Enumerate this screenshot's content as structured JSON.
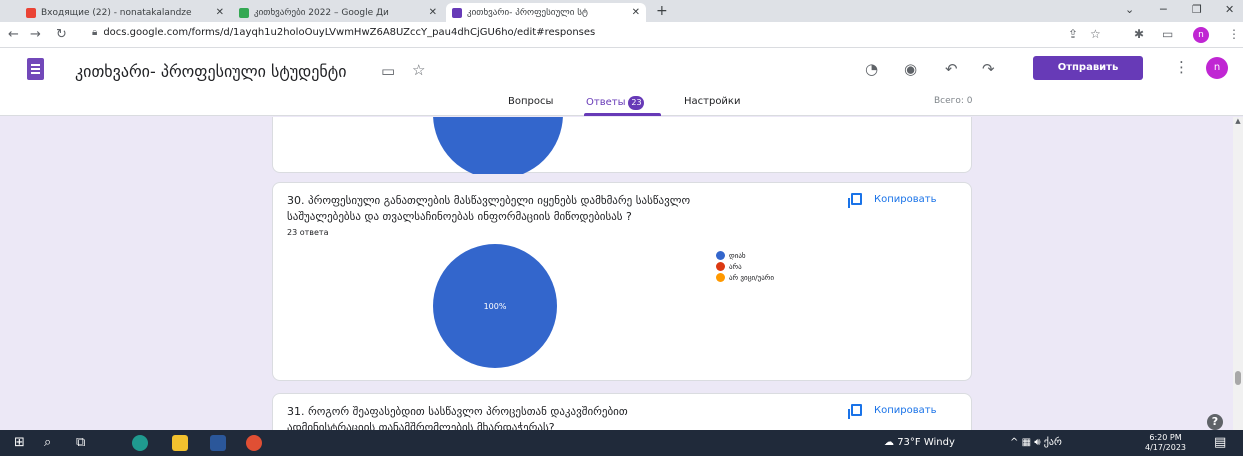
{
  "browser": {
    "tabs": [
      {
        "title": "Входящие (22) - nonatakalandze",
        "active": false,
        "color": "#ea4335"
      },
      {
        "title": "კითხვარები 2022 – Google Ди",
        "active": false,
        "color": "#34a853"
      },
      {
        "title": "კითხვარი- პროფესიული სტ",
        "active": true,
        "color": "#673ab7"
      }
    ],
    "new_tab": "+",
    "close": "✕",
    "url": "docs.google.com/forms/d/1ayqh1u2holoOuyLVwmHwZ6A8UZccY_pau4dhCjGU6ho/edit#responses"
  },
  "form": {
    "title": "კითხვარი- პროფესიული სტუდენტი",
    "send_label": "Отправить",
    "profile_initial": "n",
    "tabs": {
      "questions": "Вопросы",
      "responses": "Ответы",
      "responses_count": "23",
      "settings": "Настройки"
    },
    "total_label": "Всего: 0"
  },
  "questions": [
    {
      "title_line1": "30. პროფესიული განათლების მასწავლებელი იყენებს დამხმარე სასწავლო",
      "title_line2": "საშუალებებსა და თვალსაჩინოებას ინფორმაციის მიწოდებისას ?",
      "count": "23 ответа",
      "copy_label": "Копировать",
      "legend": [
        {
          "label": "დიახ",
          "color": "#3366cc"
        },
        {
          "label": "არა",
          "color": "#dc3912"
        },
        {
          "label": "არ ვიცი/უარი",
          "color": "#ff9900"
        }
      ],
      "slice_label": "100%"
    },
    {
      "title_line1": "31. როგორ შეაფასებდით სასწავლო პროცესთან დაკავშირებით",
      "title_line2": "ადმინისტრაციის თანამშრომლების მხარდაჭერას?",
      "copy_label": "Копировать"
    }
  ],
  "chart_data": [
    {
      "type": "pie",
      "categories": [
        "დიახ",
        "არა",
        "არ ვიცი/უარი"
      ],
      "values": [
        100,
        0,
        0
      ],
      "colors": [
        "#3366cc",
        "#dc3912",
        "#ff9900"
      ],
      "legend": "right"
    }
  ],
  "taskbar": {
    "weather": "73°F  Windy",
    "lang": "ქარ",
    "time": "6:20 PM",
    "date": "4/17/2023"
  }
}
